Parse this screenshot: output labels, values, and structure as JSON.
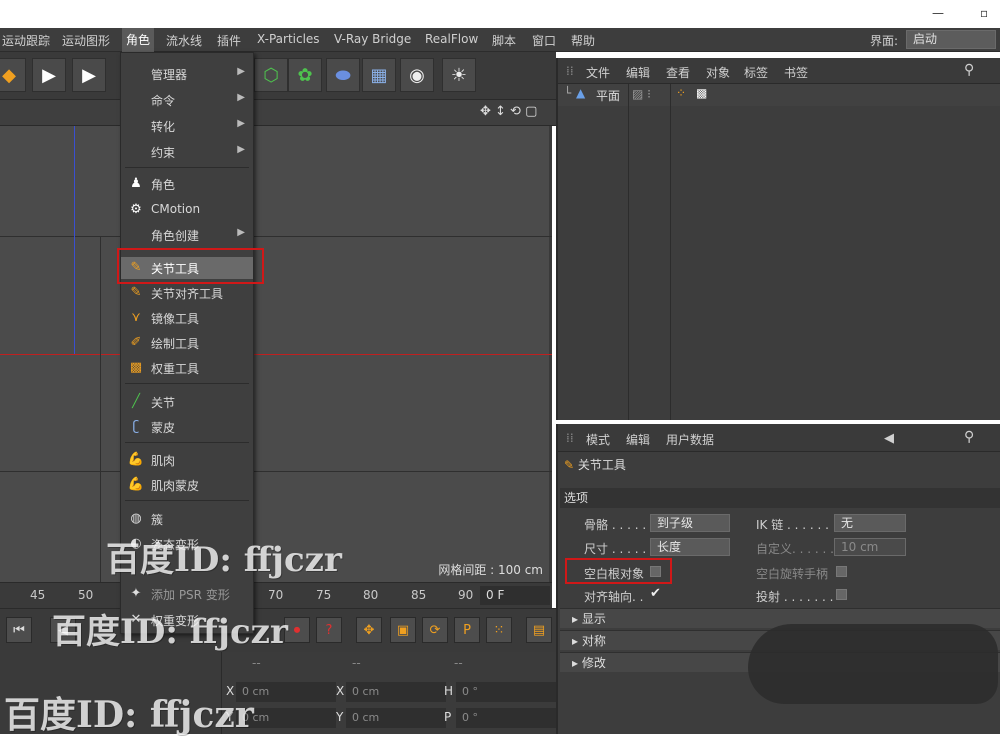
{
  "menubar": {
    "items": [
      "运动跟踪",
      "运动图形",
      "角色",
      "流水线",
      "插件",
      "X-Particles",
      "V-Ray Bridge",
      "RealFlow",
      "脚本",
      "窗口",
      "帮助"
    ],
    "layout_label": "界面:",
    "layout_value": "启动"
  },
  "context_menu": {
    "items": [
      {
        "label": "管理器",
        "submenu": true
      },
      {
        "label": "命令",
        "submenu": true
      },
      {
        "label": "转化",
        "submenu": true
      },
      {
        "label": "约束",
        "submenu": true
      },
      {
        "label": "角色",
        "icon": "character-icon"
      },
      {
        "label": "CMotion",
        "icon": "cmotion-icon"
      },
      {
        "label": "角色创建",
        "submenu": true
      },
      {
        "label": "关节工具",
        "icon": "joint-tool-icon",
        "highlighted": true
      },
      {
        "label": "关节对齐工具",
        "icon": "joint-align-icon"
      },
      {
        "label": "镜像工具",
        "icon": "mirror-icon"
      },
      {
        "label": "绘制工具",
        "icon": "paint-icon"
      },
      {
        "label": "权重工具",
        "icon": "weight-icon"
      },
      {
        "label": "关节",
        "icon": "joint-icon"
      },
      {
        "label": "蒙皮",
        "icon": "skin-icon"
      },
      {
        "label": "肌肉",
        "icon": "muscle-icon"
      },
      {
        "label": "肌肉蒙皮",
        "icon": "muscle-skin-icon"
      },
      {
        "label": "簇",
        "icon": "cluster-icon"
      },
      {
        "label": "姿态变形",
        "icon": "pose-morph-icon"
      },
      {
        "label": "添加 PSR 变形",
        "icon": "psr-icon"
      },
      {
        "label": "权重变形",
        "icon": "weight-deform-icon"
      }
    ]
  },
  "viewport": {
    "grid_spacing": "网格间距 : 100 cm"
  },
  "timeline": {
    "ticks": [
      "45",
      "50",
      "70",
      "75",
      "80",
      "85",
      "90"
    ],
    "frame": "0 F"
  },
  "coords": {
    "x_label": "X",
    "y_label": "Y",
    "h_label": "H",
    "p_label": "P",
    "x_value": "0 cm",
    "x2_value": "0 cm",
    "h_value": "0 °",
    "y_value": "0 cm",
    "y2_value": "0 cm",
    "p_value": "0 °",
    "header": "--"
  },
  "object_manager": {
    "menu": [
      "文件",
      "编辑",
      "查看",
      "对象",
      "标签",
      "书签"
    ],
    "object_name": "平面"
  },
  "attribute_manager": {
    "menu": [
      "模式",
      "编辑",
      "用户数据"
    ],
    "title": "关节工具",
    "section": "选项",
    "bone_label": "骨骼 . . . . .",
    "bone_value": "到子级",
    "ik_label": "IK 链 . . . . . . .",
    "ik_value": "无",
    "size_label": "尺寸 . . . . .",
    "size_value": "长度",
    "custom_label": "自定义. . . . . .",
    "custom_value": "10 cm",
    "null_root_label": "空白根对象",
    "null_rotate_label": "空白旋转手柄",
    "align_label": "对齐轴向. .",
    "project_label": "投射 . . . . . . .",
    "groups": [
      "显示",
      "对称",
      "修改"
    ]
  },
  "watermarks": [
    "百度ID: ffjczr",
    "百度ID: ffjczr",
    "百度ID: ffjczr"
  ],
  "colors": {
    "highlight_red": "#d01818",
    "axis_blue": "#3a4fd0",
    "axis_red": "#c02020"
  }
}
